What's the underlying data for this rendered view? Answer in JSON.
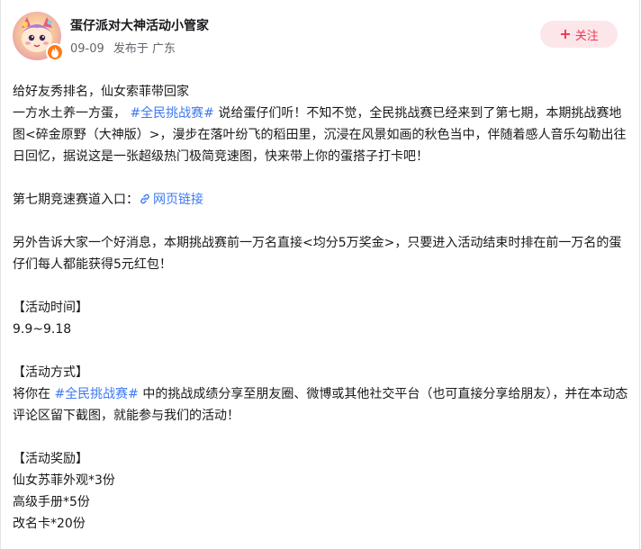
{
  "author": {
    "name": "蛋仔派对大神活动小管家",
    "date": "09-09",
    "location": "发布于 广东",
    "follow_label": "关注"
  },
  "icons": [
    "avatar",
    "fire-badge-icon",
    "plus-icon",
    "link-icon"
  ],
  "colors": {
    "topic": "#3d79f2",
    "follow_bg": "#fde6ea",
    "follow_text": "#f0344f",
    "badge": "#ff7a1a"
  },
  "post": {
    "line1": "给好友秀排名，仙女索菲带回家",
    "p2_a": "一方水土养一方蛋，",
    "topic1": "#全民挑战赛#",
    "p2_b": "说给蛋仔们听！不知不觉，全民挑战赛已经来到了第七期，本期挑战赛地图<碎金原野（大神版）>，漫步在落叶纷飞的稻田里，沉浸在风景如画的秋色当中，伴随着感人音乐勾勒出往日回忆，据说这是一张超级热门极简竞速图，快来带上你的蛋搭子打卡吧！",
    "entry_label": "第七期竞速赛道入口：",
    "entry_link": "网页链接",
    "news": "另外告诉大家一个好消息，本期挑战赛前一万名直接<均分5万奖金>，只要进入活动结束时排在前一万名的蛋仔们每人都能获得5元红包！",
    "time_title": "【活动时间】",
    "time_value": "9.9~9.18",
    "method_title": "【活动方式】",
    "method_a": "将你在",
    "topic2": "#全民挑战赛#",
    "method_b": "中的挑战成绩分享至朋友圈、微博或其他社交平台（也可直接分享给朋友），并在本动态评论区留下截图，就能参与我们的活动！",
    "reward_title": "【活动奖励】",
    "reward1": "仙女苏菲外观*3份",
    "reward2": "高级手册*5份",
    "reward3": "改名卡*20份"
  }
}
